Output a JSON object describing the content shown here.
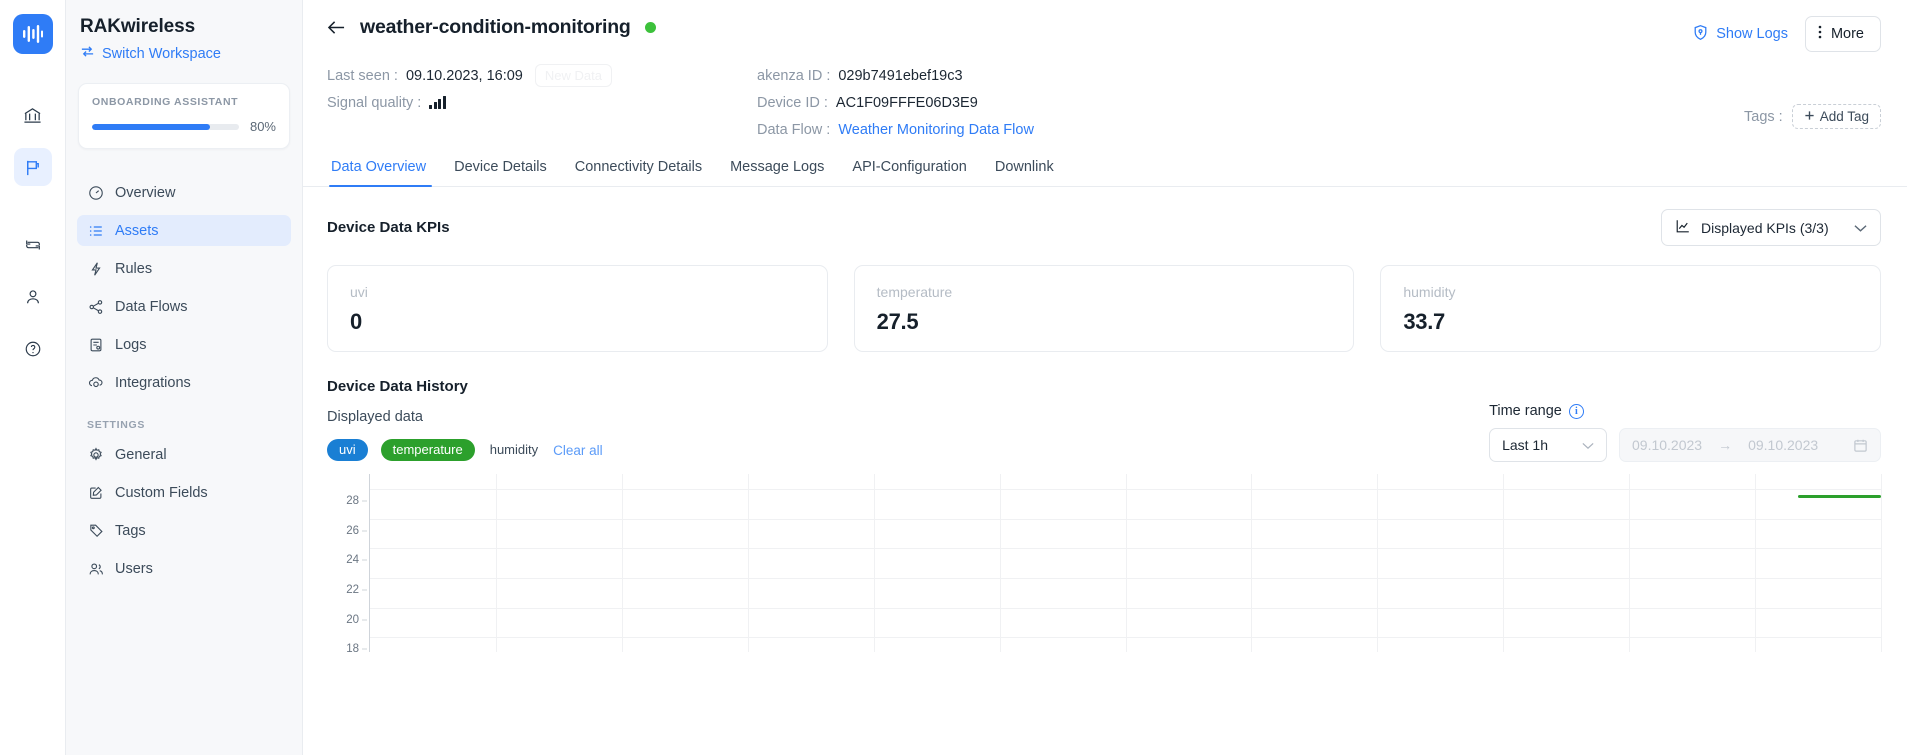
{
  "rail": {
    "logo_icon": "soundwave-logo-icon",
    "items": [
      {
        "icon": "bank-icon",
        "name": "organization",
        "active": false
      },
      {
        "icon": "flag-icon",
        "name": "workspace",
        "active": true
      },
      {
        "icon": "loop-icon",
        "name": "loop",
        "active": false
      },
      {
        "icon": "user-icon",
        "name": "account",
        "active": false
      },
      {
        "icon": "help-circle-icon",
        "name": "help",
        "active": false
      }
    ]
  },
  "sidebar": {
    "workspace_name": "RAKwireless",
    "switch_workspace": "Switch Workspace",
    "switch_icon": "switch-arrows-icon",
    "onboarding": {
      "title": "ONBOARDING ASSISTANT",
      "percent_label": "80%",
      "percent_value": 80
    },
    "items": [
      {
        "label": "Overview",
        "icon": "gauge-icon",
        "active": false
      },
      {
        "label": "Assets",
        "icon": "list-icon",
        "active": true
      },
      {
        "label": "Rules",
        "icon": "lightning-icon",
        "active": false
      },
      {
        "label": "Data Flows",
        "icon": "share-nodes-icon",
        "active": false
      },
      {
        "label": "Logs",
        "icon": "document-log-icon",
        "active": false
      },
      {
        "label": "Integrations",
        "icon": "cloud-icon",
        "active": false
      }
    ],
    "settings_label": "SETTINGS",
    "settings_items": [
      {
        "label": "General",
        "icon": "gear-icon"
      },
      {
        "label": "Custom Fields",
        "icon": "edit-square-icon"
      },
      {
        "label": "Tags",
        "icon": "tag-icon"
      },
      {
        "label": "Users",
        "icon": "users-icon"
      }
    ]
  },
  "header": {
    "back_icon": "arrow-left-icon",
    "title": "weather-condition-monitoring",
    "status": "online",
    "status_color": "#3cc13b",
    "show_logs": "Show Logs",
    "show_logs_icon": "shield-logs-icon",
    "more": "More",
    "more_icon": "dots-vertical-icon"
  },
  "meta": {
    "last_seen_label": "Last seen :",
    "last_seen_value": "09.10.2023, 16:09",
    "new_data_badge": "New Data",
    "signal_label": "Signal quality :",
    "signal_icon": "signal-bars-icon",
    "signal_bars": 4,
    "akenza_id_label": "akenza ID :",
    "akenza_id_value": "029b7491ebef19c3",
    "device_id_label": "Device ID :",
    "device_id_value": "AC1F09FFFE06D3E9",
    "data_flow_label": "Data Flow :",
    "data_flow_value": "Weather Monitoring Data Flow",
    "tags_label": "Tags :",
    "add_tag": "Add Tag",
    "add_tag_icon": "plus-icon"
  },
  "tabs": [
    {
      "label": "Data Overview",
      "active": true
    },
    {
      "label": "Device Details",
      "active": false
    },
    {
      "label": "Connectivity Details",
      "active": false
    },
    {
      "label": "Message Logs",
      "active": false
    },
    {
      "label": "API-Configuration",
      "active": false
    },
    {
      "label": "Downlink",
      "active": false
    }
  ],
  "kpi_section": {
    "title": "Device Data KPIs",
    "selector_label": "Displayed KPIs (3/3)",
    "selector_icon": "line-chart-icon",
    "selector_caret": "chevron-down-icon",
    "cards": [
      {
        "name": "uvi",
        "value": "0"
      },
      {
        "name": "temperature",
        "value": "27.5"
      },
      {
        "name": "humidity",
        "value": "33.7"
      }
    ]
  },
  "history": {
    "title": "Device Data History",
    "displayed_data_label": "Displayed data",
    "chips": [
      {
        "label": "uvi",
        "color": "#1a7fd4",
        "selected": true
      },
      {
        "label": "temperature",
        "color": "#2ca02c",
        "selected": true
      },
      {
        "label": "humidity",
        "color": "",
        "selected": false
      }
    ],
    "clear_all": "Clear all",
    "time_range_label": "Time range",
    "time_range_info_icon": "info-circle-icon",
    "range_select_value": "Last 1h",
    "range_caret": "chevron-down-icon",
    "date_from": "09.10.2023",
    "date_to": "09.10.2023",
    "date_arrow": "→",
    "calendar_icon": "calendar-icon"
  },
  "chart_data": {
    "type": "line",
    "title": "Device Data History",
    "xlabel": "",
    "ylabel": "",
    "ylim": [
      17,
      29
    ],
    "yticks": [
      28,
      26,
      24,
      22,
      20,
      18
    ],
    "grid": true,
    "legend": "none",
    "x_gridline_count": 12,
    "series": [
      {
        "name": "temperature",
        "color": "#2ca02c",
        "x": [
          0.945,
          1.0
        ],
        "values": [
          27.5,
          27.5
        ]
      },
      {
        "name": "uvi",
        "color": "#1a7fd4",
        "x": [],
        "values": []
      }
    ]
  }
}
